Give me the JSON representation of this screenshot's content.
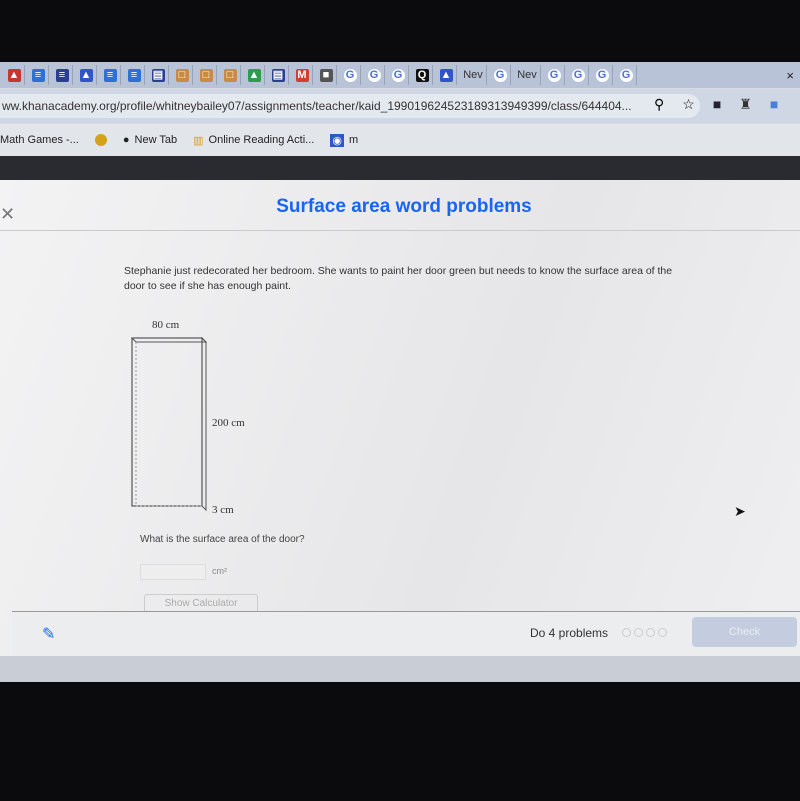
{
  "browser": {
    "tabs": [
      {
        "icon": "slides-icon",
        "color": "#c8372d",
        "glyph": "▲"
      },
      {
        "icon": "docs-icon",
        "color": "#2f6fd8",
        "glyph": "≡"
      },
      {
        "icon": "sheets-icon",
        "color": "#2a3f8f",
        "glyph": "≡"
      },
      {
        "icon": "classroom-icon",
        "color": "#2f55c8",
        "glyph": "▲"
      },
      {
        "icon": "docs-icon",
        "color": "#2f6fd8",
        "glyph": "≡"
      },
      {
        "icon": "docs-icon",
        "color": "#2f6fd8",
        "glyph": "≡"
      },
      {
        "icon": "forms-icon",
        "color": "#2a3f8f",
        "glyph": "▤"
      },
      {
        "icon": "slides-icon",
        "color": "#c98a46",
        "glyph": "□"
      },
      {
        "icon": "slides-icon",
        "color": "#c98a46",
        "glyph": "□"
      },
      {
        "icon": "slides-icon",
        "color": "#c98a46",
        "glyph": "□"
      },
      {
        "icon": "drive-icon",
        "color": "#2d9d4d",
        "glyph": "▲"
      },
      {
        "icon": "forms-icon",
        "color": "#2a3f8f",
        "glyph": "▤"
      },
      {
        "icon": "gmail-icon",
        "color": "#d23f31",
        "glyph": "M"
      },
      {
        "icon": "chat-icon",
        "color": "#555",
        "glyph": "■"
      },
      {
        "icon": "google-icon",
        "color": "#4a6fd8",
        "glyph": "G"
      },
      {
        "icon": "google-icon",
        "color": "#4a6fd8",
        "glyph": "G"
      },
      {
        "icon": "google-icon",
        "color": "#4a6fd8",
        "glyph": "G"
      },
      {
        "icon": "quizlet-icon",
        "color": "#111",
        "glyph": "Q"
      },
      {
        "icon": "classroom-icon",
        "color": "#2f55c8",
        "glyph": "▲"
      },
      {
        "icon": "text",
        "label": "Nev"
      },
      {
        "icon": "google-icon",
        "color": "#4a6fd8",
        "glyph": "G"
      },
      {
        "icon": "text",
        "label": "Nev"
      },
      {
        "icon": "google-icon",
        "color": "#4a6fd8",
        "glyph": "G"
      },
      {
        "icon": "google-icon",
        "color": "#4a6fd8",
        "glyph": "G"
      },
      {
        "icon": "google-icon",
        "color": "#4a6fd8",
        "glyph": "G"
      },
      {
        "icon": "google-icon",
        "color": "#4a6fd8",
        "glyph": "G"
      }
    ],
    "close": "×",
    "url": "ww.khanacademy.org/profile/whitneybailey07/assignments/teacher/kaid_199019624523189313949399/class/644404...",
    "bookmarks": [
      {
        "label": "Math Games -...",
        "icon": "none"
      },
      {
        "label": "",
        "icon": "circle-icon"
      },
      {
        "label": "New Tab",
        "icon": "globe-icon"
      },
      {
        "label": "Online Reading Acti...",
        "icon": "chart-icon"
      },
      {
        "label": "m",
        "icon": "bookmark-app-icon"
      }
    ]
  },
  "exercise": {
    "title": "Surface area word problems",
    "accent": "#1865f2",
    "problem_text": "Stephanie just redecorated her bedroom. She wants to paint her door green but needs to know the surface area of the door to see if she has enough paint.",
    "figure": {
      "width_label": "80 cm",
      "height_label": "200 cm",
      "depth_label": "3 cm"
    },
    "question": "What is the surface area of the door?",
    "answer_value": "",
    "unit": "cm²",
    "show_calculator": "Show Calculator"
  },
  "footer": {
    "progress_text": "Do 4 problems",
    "problems_total": 4,
    "problems_done": 0,
    "check": "Check"
  }
}
